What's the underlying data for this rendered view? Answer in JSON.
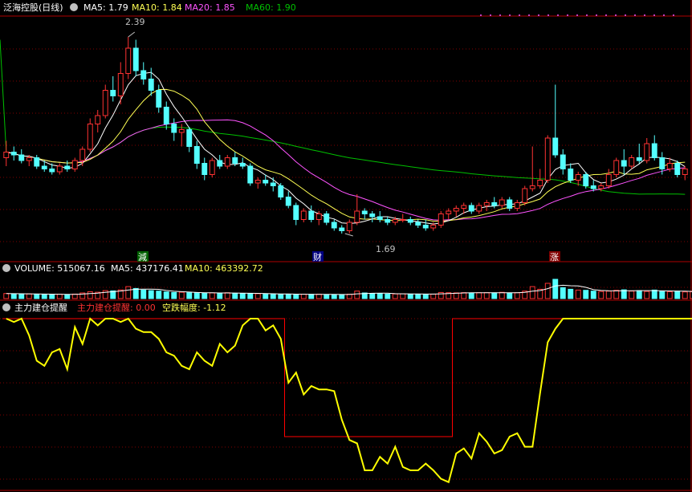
{
  "header": {
    "title": "泛海控股(日线)",
    "ma5_label": "MA5: 1.79",
    "ma10_label": "MA10: 1.84",
    "ma20_label": "MA20: 1.85",
    "ma60_label": "MA60: 1.90"
  },
  "volume_header": {
    "volume_label": "VOLUME: 515067.16",
    "ma5_label": "MA5: 437176.41",
    "ma10_label": "MA10: 463392.72"
  },
  "indicator_header": {
    "name": "主力建仓提醒",
    "signal_label": "主力建仓提醒: 0.00",
    "drop_label": "空跌幅度: -1.12"
  },
  "markers": {
    "high_label": "2.39",
    "low_label": "1.69",
    "event_1": "減",
    "event_2": "财",
    "event_3": "涨"
  },
  "colors": {
    "background": "#000000",
    "up": "#ff3232",
    "down": "#54ffff",
    "ma5": "#ffffff",
    "ma10": "#ffff54",
    "ma20": "#ff54ff",
    "ma60": "#00c000",
    "grid": "#800000",
    "border": "#b00000",
    "indicator_line": "#ffff00",
    "signal_line": "#ff0000"
  },
  "chart_data": {
    "type": "candlestick",
    "title": "泛海控股(日线)",
    "price_range": [
      1.65,
      2.45
    ],
    "price_high": 2.39,
    "price_low": 1.69,
    "candles": [
      {
        "o": 1.96,
        "h": 2.02,
        "l": 1.93,
        "c": 1.98
      },
      {
        "o": 1.98,
        "h": 2.0,
        "l": 1.95,
        "c": 1.97
      },
      {
        "o": 1.97,
        "h": 1.99,
        "l": 1.94,
        "c": 1.95
      },
      {
        "o": 1.95,
        "h": 1.97,
        "l": 1.93,
        "c": 1.96
      },
      {
        "o": 1.96,
        "h": 1.97,
        "l": 1.92,
        "c": 1.93
      },
      {
        "o": 1.93,
        "h": 1.95,
        "l": 1.91,
        "c": 1.92
      },
      {
        "o": 1.92,
        "h": 1.94,
        "l": 1.9,
        "c": 1.91
      },
      {
        "o": 1.91,
        "h": 1.94,
        "l": 1.9,
        "c": 1.93
      },
      {
        "o": 1.93,
        "h": 1.95,
        "l": 1.91,
        "c": 1.92
      },
      {
        "o": 1.92,
        "h": 1.96,
        "l": 1.91,
        "c": 1.95
      },
      {
        "o": 1.95,
        "h": 2.0,
        "l": 1.93,
        "c": 1.99
      },
      {
        "o": 1.99,
        "h": 2.1,
        "l": 1.98,
        "c": 2.08
      },
      {
        "o": 2.08,
        "h": 2.13,
        "l": 2.05,
        "c": 2.11
      },
      {
        "o": 2.11,
        "h": 2.22,
        "l": 2.1,
        "c": 2.2
      },
      {
        "o": 2.2,
        "h": 2.25,
        "l": 2.16,
        "c": 2.18
      },
      {
        "o": 2.18,
        "h": 2.3,
        "l": 2.15,
        "c": 2.26
      },
      {
        "o": 2.26,
        "h": 2.39,
        "l": 2.24,
        "c": 2.35
      },
      {
        "o": 2.35,
        "h": 2.38,
        "l": 2.25,
        "c": 2.27
      },
      {
        "o": 2.27,
        "h": 2.3,
        "l": 2.22,
        "c": 2.24
      },
      {
        "o": 2.24,
        "h": 2.28,
        "l": 2.18,
        "c": 2.2
      },
      {
        "o": 2.2,
        "h": 2.22,
        "l": 2.12,
        "c": 2.14
      },
      {
        "o": 2.14,
        "h": 2.16,
        "l": 2.06,
        "c": 2.08
      },
      {
        "o": 2.08,
        "h": 2.1,
        "l": 2.02,
        "c": 2.05
      },
      {
        "o": 2.05,
        "h": 2.08,
        "l": 2.0,
        "c": 2.06
      },
      {
        "o": 2.06,
        "h": 2.07,
        "l": 1.98,
        "c": 2.0
      },
      {
        "o": 2.0,
        "h": 2.02,
        "l": 1.92,
        "c": 1.94
      },
      {
        "o": 1.94,
        "h": 1.96,
        "l": 1.88,
        "c": 1.9
      },
      {
        "o": 1.9,
        "h": 1.96,
        "l": 1.89,
        "c": 1.95
      },
      {
        "o": 1.95,
        "h": 1.97,
        "l": 1.92,
        "c": 1.93
      },
      {
        "o": 1.93,
        "h": 1.97,
        "l": 1.92,
        "c": 1.96
      },
      {
        "o": 1.96,
        "h": 1.98,
        "l": 1.93,
        "c": 1.94
      },
      {
        "o": 1.94,
        "h": 1.96,
        "l": 1.92,
        "c": 1.93
      },
      {
        "o": 1.93,
        "h": 1.94,
        "l": 1.86,
        "c": 1.87
      },
      {
        "o": 1.87,
        "h": 1.89,
        "l": 1.85,
        "c": 1.88
      },
      {
        "o": 1.88,
        "h": 1.9,
        "l": 1.86,
        "c": 1.87
      },
      {
        "o": 1.87,
        "h": 1.89,
        "l": 1.84,
        "c": 1.86
      },
      {
        "o": 1.86,
        "h": 1.87,
        "l": 1.81,
        "c": 1.82
      },
      {
        "o": 1.82,
        "h": 1.84,
        "l": 1.78,
        "c": 1.79
      },
      {
        "o": 1.79,
        "h": 1.8,
        "l": 1.72,
        "c": 1.74
      },
      {
        "o": 1.74,
        "h": 1.78,
        "l": 1.73,
        "c": 1.77
      },
      {
        "o": 1.77,
        "h": 1.79,
        "l": 1.73,
        "c": 1.74
      },
      {
        "o": 1.74,
        "h": 1.77,
        "l": 1.72,
        "c": 1.76
      },
      {
        "o": 1.76,
        "h": 1.77,
        "l": 1.72,
        "c": 1.73
      },
      {
        "o": 1.73,
        "h": 1.74,
        "l": 1.7,
        "c": 1.71
      },
      {
        "o": 1.71,
        "h": 1.72,
        "l": 1.69,
        "c": 1.7
      },
      {
        "o": 1.7,
        "h": 1.74,
        "l": 1.69,
        "c": 1.73
      },
      {
        "o": 1.73,
        "h": 1.83,
        "l": 1.72,
        "c": 1.77
      },
      {
        "o": 1.77,
        "h": 1.78,
        "l": 1.74,
        "c": 1.76
      },
      {
        "o": 1.76,
        "h": 1.77,
        "l": 1.73,
        "c": 1.75
      },
      {
        "o": 1.75,
        "h": 1.77,
        "l": 1.73,
        "c": 1.74
      },
      {
        "o": 1.74,
        "h": 1.75,
        "l": 1.72,
        "c": 1.73
      },
      {
        "o": 1.73,
        "h": 1.75,
        "l": 1.72,
        "c": 1.74
      },
      {
        "o": 1.74,
        "h": 1.76,
        "l": 1.73,
        "c": 1.74
      },
      {
        "o": 1.74,
        "h": 1.75,
        "l": 1.72,
        "c": 1.73
      },
      {
        "o": 1.73,
        "h": 1.74,
        "l": 1.71,
        "c": 1.72
      },
      {
        "o": 1.72,
        "h": 1.74,
        "l": 1.7,
        "c": 1.71
      },
      {
        "o": 1.71,
        "h": 1.73,
        "l": 1.7,
        "c": 1.72
      },
      {
        "o": 1.72,
        "h": 1.77,
        "l": 1.71,
        "c": 1.76
      },
      {
        "o": 1.76,
        "h": 1.78,
        "l": 1.74,
        "c": 1.77
      },
      {
        "o": 1.77,
        "h": 1.79,
        "l": 1.75,
        "c": 1.78
      },
      {
        "o": 1.78,
        "h": 1.8,
        "l": 1.76,
        "c": 1.79
      },
      {
        "o": 1.79,
        "h": 1.8,
        "l": 1.76,
        "c": 1.77
      },
      {
        "o": 1.77,
        "h": 1.8,
        "l": 1.76,
        "c": 1.79
      },
      {
        "o": 1.79,
        "h": 1.81,
        "l": 1.77,
        "c": 1.8
      },
      {
        "o": 1.8,
        "h": 1.82,
        "l": 1.78,
        "c": 1.79
      },
      {
        "o": 1.79,
        "h": 1.82,
        "l": 1.78,
        "c": 1.81
      },
      {
        "o": 1.81,
        "h": 1.82,
        "l": 1.77,
        "c": 1.78
      },
      {
        "o": 1.78,
        "h": 1.81,
        "l": 1.77,
        "c": 1.8
      },
      {
        "o": 1.8,
        "h": 1.86,
        "l": 1.79,
        "c": 1.85
      },
      {
        "o": 1.85,
        "h": 2.0,
        "l": 1.84,
        "c": 1.86
      },
      {
        "o": 1.86,
        "h": 1.92,
        "l": 1.85,
        "c": 1.88
      },
      {
        "o": 1.88,
        "h": 2.04,
        "l": 1.87,
        "c": 2.03
      },
      {
        "o": 2.03,
        "h": 2.22,
        "l": 1.96,
        "c": 1.97
      },
      {
        "o": 1.97,
        "h": 1.99,
        "l": 1.9,
        "c": 1.92
      },
      {
        "o": 1.92,
        "h": 1.94,
        "l": 1.87,
        "c": 1.88
      },
      {
        "o": 1.88,
        "h": 1.91,
        "l": 1.86,
        "c": 1.9
      },
      {
        "o": 1.9,
        "h": 1.91,
        "l": 1.85,
        "c": 1.86
      },
      {
        "o": 1.86,
        "h": 1.88,
        "l": 1.84,
        "c": 1.85
      },
      {
        "o": 1.85,
        "h": 1.87,
        "l": 1.84,
        "c": 1.86
      },
      {
        "o": 1.86,
        "h": 1.92,
        "l": 1.85,
        "c": 1.9
      },
      {
        "o": 1.9,
        "h": 1.96,
        "l": 1.89,
        "c": 1.95
      },
      {
        "o": 1.95,
        "h": 1.99,
        "l": 1.9,
        "c": 1.93
      },
      {
        "o": 1.93,
        "h": 1.97,
        "l": 1.92,
        "c": 1.96
      },
      {
        "o": 1.96,
        "h": 2.01,
        "l": 1.94,
        "c": 1.95
      },
      {
        "o": 1.95,
        "h": 2.03,
        "l": 1.94,
        "c": 2.01
      },
      {
        "o": 2.01,
        "h": 2.04,
        "l": 1.95,
        "c": 1.96
      },
      {
        "o": 1.96,
        "h": 1.98,
        "l": 1.9,
        "c": 1.92
      },
      {
        "o": 1.92,
        "h": 1.96,
        "l": 1.91,
        "c": 1.94
      },
      {
        "o": 1.94,
        "h": 1.95,
        "l": 1.89,
        "c": 1.9
      },
      {
        "o": 1.9,
        "h": 1.93,
        "l": 1.88,
        "c": 1.92
      }
    ],
    "volume": {
      "title": "VOLUME",
      "values": [
        380,
        360,
        340,
        350,
        330,
        320,
        310,
        330,
        300,
        340,
        420,
        520,
        480,
        600,
        580,
        650,
        900,
        760,
        640,
        600,
        560,
        500,
        460,
        480,
        440,
        420,
        400,
        430,
        410,
        440,
        400,
        380,
        360,
        370,
        350,
        340,
        330,
        320,
        310,
        330,
        320,
        330,
        300,
        290,
        300,
        330,
        560,
        420,
        380,
        360,
        340,
        350,
        360,
        340,
        330,
        320,
        330,
        460,
        440,
        430,
        450,
        420,
        440,
        450,
        430,
        470,
        420,
        440,
        560,
        900,
        700,
        1150,
        1450,
        820,
        700,
        640,
        620,
        560,
        540,
        560,
        620,
        660,
        560,
        600,
        540,
        640,
        560,
        520,
        560,
        500,
        515
      ]
    },
    "indicator": {
      "title": "主力建仓提醒",
      "range": [
        0,
        100
      ],
      "yellow_values": [
        100,
        98,
        100,
        90,
        75,
        72,
        80,
        82,
        70,
        95,
        85,
        100,
        96,
        100,
        100,
        98,
        100,
        94,
        92,
        92,
        88,
        80,
        78,
        72,
        70,
        80,
        75,
        72,
        85,
        80,
        84,
        96,
        100,
        100,
        93,
        96,
        88,
        62,
        68,
        55,
        60,
        58,
        58,
        57,
        40,
        28,
        26,
        10,
        10,
        18,
        14,
        24,
        12,
        10,
        10,
        14,
        10,
        5,
        3,
        20,
        23,
        17,
        32,
        27,
        20,
        22,
        30,
        32,
        24,
        24,
        56,
        86,
        94,
        100,
        100,
        100,
        100,
        100,
        100,
        100,
        100,
        100,
        100,
        100,
        100,
        100,
        100,
        100,
        100,
        100,
        100
      ],
      "red_signal": [
        100,
        100,
        100,
        100,
        100,
        100,
        100,
        100,
        100,
        100,
        100,
        100,
        100,
        100,
        100,
        100,
        100,
        100,
        100,
        100,
        100,
        100,
        100,
        100,
        100,
        100,
        100,
        100,
        100,
        100,
        100,
        100,
        100,
        100,
        100,
        100,
        100,
        30,
        30,
        30,
        30,
        30,
        30,
        30,
        30,
        30,
        30,
        30,
        30,
        30,
        30,
        30,
        30,
        30,
        30,
        30,
        30,
        30,
        30,
        100,
        100,
        100,
        100,
        100,
        100,
        100,
        100,
        100,
        100,
        100,
        100,
        100,
        100,
        100,
        100,
        100,
        100,
        100,
        100,
        100,
        100,
        100,
        100,
        100,
        100,
        100,
        100,
        100,
        100,
        100,
        100
      ]
    }
  }
}
